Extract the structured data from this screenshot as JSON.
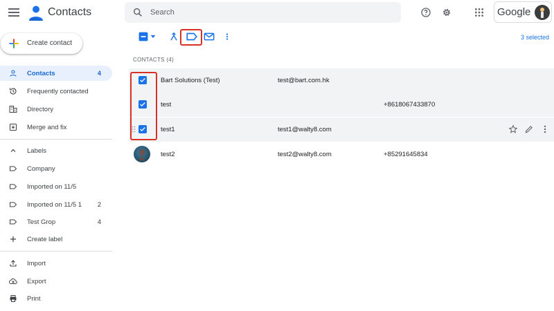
{
  "header": {
    "app_title": "Contacts",
    "search_placeholder": "Search",
    "account_brand": "Google"
  },
  "sidebar": {
    "create_label": "Create contact",
    "nav": [
      {
        "label": "Contacts",
        "count": "4",
        "icon": "person-icon",
        "active": true
      },
      {
        "label": "Frequently contacted",
        "count": "",
        "icon": "history-icon"
      },
      {
        "label": "Directory",
        "count": "",
        "icon": "domain-icon"
      },
      {
        "label": "Merge and fix",
        "count": "",
        "icon": "merge-icon"
      }
    ],
    "labels_heading": "Labels",
    "labels": [
      {
        "label": "Company",
        "count": ""
      },
      {
        "label": "Imported on 11/5",
        "count": ""
      },
      {
        "label": "Imported on 11/5 1",
        "count": "2"
      },
      {
        "label": "Test Grop",
        "count": "4"
      }
    ],
    "create_label_label": "Create label",
    "tools": [
      {
        "label": "Import",
        "icon": "upload-icon"
      },
      {
        "label": "Export",
        "icon": "cloud-download-icon"
      },
      {
        "label": "Print",
        "icon": "printer-icon"
      }
    ]
  },
  "toolbar": {
    "selected_count": "3 selected"
  },
  "contacts": {
    "heading": "CONTACTS (4)",
    "rows": [
      {
        "name": "Bart Solutions (Test)",
        "email": "test@bart.com.hk",
        "phone": "",
        "selected": true
      },
      {
        "name": "test",
        "email": "",
        "phone": "+8618067433870",
        "selected": true
      },
      {
        "name": "test1",
        "email": "test1@walty8.com",
        "phone": "",
        "selected": true
      },
      {
        "name": "test2",
        "email": "test2@walty8.com",
        "phone": "+85291645834",
        "selected": false
      }
    ]
  },
  "colors": {
    "accent": "#1a73e8",
    "active_bg": "#e8f0fe",
    "highlight": "#d93025",
    "selected_row": "#f1f3f4"
  }
}
